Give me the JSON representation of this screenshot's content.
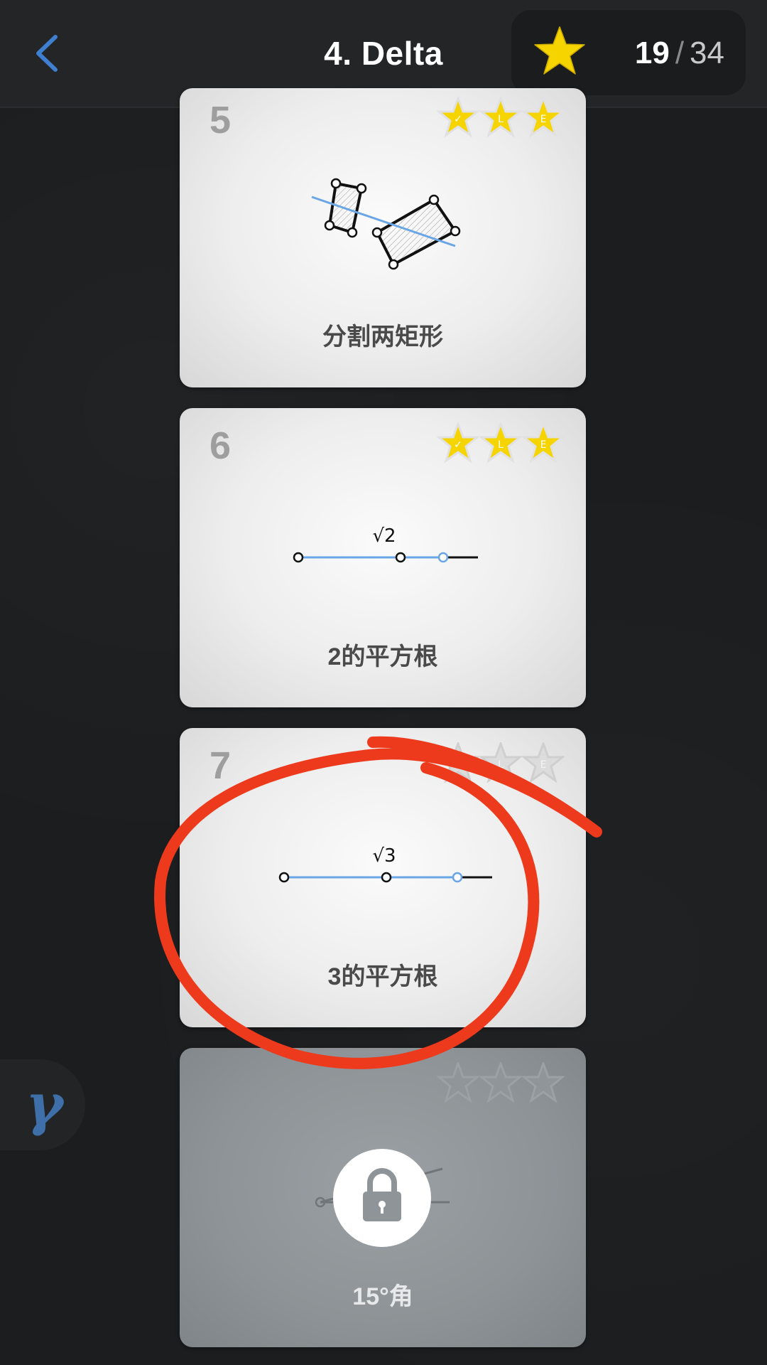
{
  "header": {
    "back_icon": "chevron-left-icon",
    "title": "4. Delta",
    "score": {
      "earned": "19",
      "separator": "/",
      "total": "34",
      "icon": "star-icon"
    }
  },
  "levels": [
    {
      "number": "5",
      "label": "分割两矩形",
      "stars": [
        "✓",
        "L",
        "E"
      ],
      "earned": [
        true,
        true,
        true
      ],
      "locked": false
    },
    {
      "number": "6",
      "label": "2的平方根",
      "stars": [
        "✓",
        "L",
        "E"
      ],
      "earned": [
        true,
        true,
        true
      ],
      "locked": false,
      "figure_label": "√2"
    },
    {
      "number": "7",
      "label": "3的平方根",
      "stars": [
        "✓",
        "L",
        "E"
      ],
      "earned": [
        false,
        false,
        false
      ],
      "locked": false,
      "figure_label": "√3"
    },
    {
      "number": "",
      "label": "15°角",
      "stars": [
        "✓",
        "L",
        "E"
      ],
      "earned": [
        false,
        false,
        false
      ],
      "locked": true,
      "icon": "lock-icon"
    }
  ],
  "side_tab": {
    "label": "γ"
  },
  "colors": {
    "accent": "#3f6fa8",
    "star": "#f5d400",
    "annotation": "#ee3a1c",
    "figure_line": "#6aa6e6"
  }
}
